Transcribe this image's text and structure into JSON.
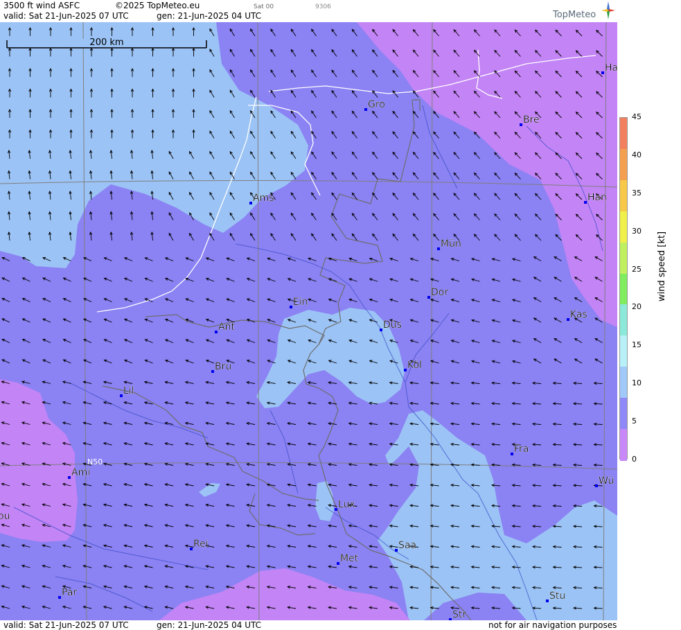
{
  "header": {
    "product": "3500 ft wind ASFC",
    "copyright": "©2025 TopMeteo.eu",
    "mini_day": "Sat 00",
    "mini_code": "9306",
    "valid": "valid:  Sat  21-Jun-2025  07 UTC",
    "generated": "gen: 21-Jun-2025 04 UTC"
  },
  "footer": {
    "valid": "valid:  Sat  21-Jun-2025  07 UTC",
    "generated": "gen: 21-Jun-2025 04 UTC",
    "disclaimer": "not for air navigation purposes"
  },
  "logo": {
    "text": "TopMeteo"
  },
  "scale_bar": {
    "label": "200 km"
  },
  "latitude_label": "N50",
  "colorbar": {
    "unit_label": "wind speed [kt]",
    "ticks": [
      "45",
      "40",
      "35",
      "30",
      "25",
      "20",
      "15",
      "10",
      "5",
      "0"
    ],
    "colors": [
      "#f28060",
      "#f4a050",
      "#f8c848",
      "#f0f04a",
      "#c0f060",
      "#80ec60",
      "#8ce8d8",
      "#b8f0f8",
      "#a0c8f8",
      "#8e88f8",
      "#c888f8"
    ]
  },
  "wind_colors": {
    "band_0_5": "#c384f6",
    "band_5_10": "#8b82f3",
    "band_10_15": "#9bc3f5"
  },
  "cities": [
    {
      "name": "Gro"
    },
    {
      "name": "Bre"
    },
    {
      "name": "Ha"
    },
    {
      "name": "Ams"
    },
    {
      "name": "Han"
    },
    {
      "name": "Mün"
    },
    {
      "name": "Dor"
    },
    {
      "name": "Ein"
    },
    {
      "name": "Düs"
    },
    {
      "name": "Kas"
    },
    {
      "name": "Ant"
    },
    {
      "name": "Köl"
    },
    {
      "name": "Bru"
    },
    {
      "name": "Lil"
    },
    {
      "name": "Fra"
    },
    {
      "name": "Ami"
    },
    {
      "name": "Wü"
    },
    {
      "name": "Lux"
    },
    {
      "name": "ou"
    },
    {
      "name": "Rei"
    },
    {
      "name": "Saa"
    },
    {
      "name": "Met"
    },
    {
      "name": "Par"
    },
    {
      "name": "Stu"
    },
    {
      "name": "Str"
    }
  ]
}
